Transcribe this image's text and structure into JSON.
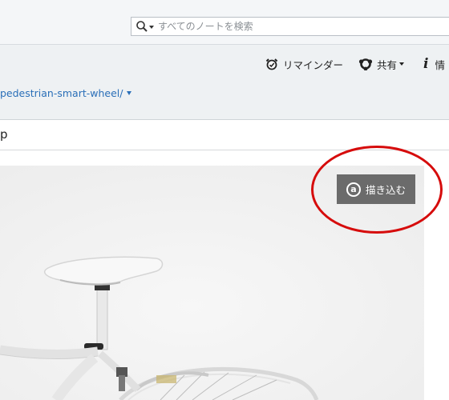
{
  "search": {
    "placeholder": "すべてのノートを検索"
  },
  "toolbar": {
    "reminder_label": "リマインダー",
    "share_label": "共有",
    "info_label": "情"
  },
  "note": {
    "source_url": "pedestrian-smart-wheel/",
    "title": "p"
  },
  "clipper": {
    "button_label": "描き込む",
    "icon_glyph": "a"
  },
  "icons": {
    "search": "search-icon",
    "reminder": "alarm-clock-icon",
    "share": "share-icon",
    "info": "info-icon"
  },
  "colors": {
    "link": "#2a6fb8",
    "highlight": "#d60c0c",
    "clip_button": "#6b6b6b"
  }
}
